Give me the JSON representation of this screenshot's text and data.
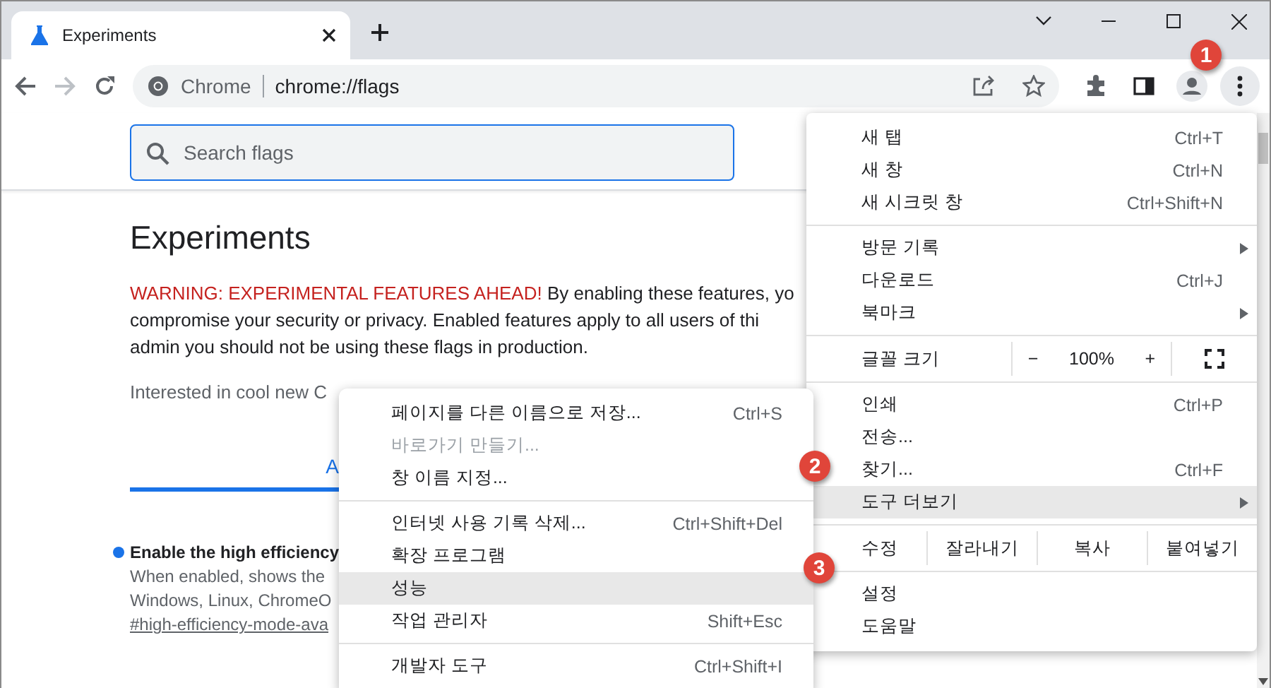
{
  "tab": {
    "title": "Experiments"
  },
  "toolbar": {
    "origin": "Chrome",
    "url": "chrome://flags"
  },
  "search": {
    "placeholder": "Search flags"
  },
  "page": {
    "heading": "Experiments",
    "warning": "WARNING: EXPERIMENTAL FEATURES AHEAD!",
    "warning_lines": [
      "By enabling these features, yo",
      "compromise your security or privacy. Enabled features apply to all users of thi",
      "admin you should not be using these flags in production."
    ],
    "interest": "Interested in cool new C",
    "tab_label": "A",
    "flag": {
      "title": "Enable the high efficiency",
      "lines": [
        "When enabled, shows the",
        "Windows, Linux, ChromeO"
      ],
      "link": "#high-efficiency-mode-ava"
    }
  },
  "main_menu": {
    "sections": [
      {
        "kind": "items",
        "items": [
          {
            "label": "새 탭",
            "shortcut": "Ctrl+T",
            "submenu": false,
            "highlighted": false,
            "disabled": false
          },
          {
            "label": "새 창",
            "shortcut": "Ctrl+N",
            "submenu": false,
            "highlighted": false,
            "disabled": false
          },
          {
            "label": "새 시크릿 창",
            "shortcut": "Ctrl+Shift+N",
            "submenu": false,
            "highlighted": false,
            "disabled": false
          }
        ]
      },
      {
        "kind": "items",
        "items": [
          {
            "label": "방문 기록",
            "submenu": true,
            "highlighted": false,
            "disabled": false
          },
          {
            "label": "다운로드",
            "shortcut": "Ctrl+J",
            "submenu": false,
            "highlighted": false,
            "disabled": false
          },
          {
            "label": "북마크",
            "submenu": true,
            "highlighted": false,
            "disabled": false
          }
        ]
      },
      {
        "kind": "zoom",
        "label": "글꼴 크기",
        "minus": "−",
        "value": "100%",
        "plus": "+"
      },
      {
        "kind": "items",
        "items": [
          {
            "label": "인쇄",
            "shortcut": "Ctrl+P",
            "submenu": false,
            "highlighted": false,
            "disabled": false
          },
          {
            "label": "전송...",
            "submenu": false,
            "highlighted": false,
            "disabled": false
          },
          {
            "label": "찾기...",
            "shortcut": "Ctrl+F",
            "submenu": false,
            "highlighted": false,
            "disabled": false
          },
          {
            "label": "도구 더보기",
            "submenu": true,
            "highlighted": true,
            "disabled": false
          }
        ]
      },
      {
        "kind": "edit",
        "label": "수정",
        "actions": [
          "잘라내기",
          "복사",
          "붙여넣기"
        ]
      },
      {
        "kind": "items",
        "items": [
          {
            "label": "설정",
            "submenu": false,
            "highlighted": false,
            "disabled": false
          },
          {
            "label": "도움말",
            "submenu": false,
            "highlighted": false,
            "disabled": false
          }
        ]
      }
    ]
  },
  "submenu": {
    "sections": [
      {
        "kind": "items",
        "items": [
          {
            "label": "페이지를 다른 이름으로 저장...",
            "shortcut": "Ctrl+S",
            "submenu": false,
            "highlighted": false,
            "disabled": false
          },
          {
            "label": "바로가기 만들기...",
            "submenu": false,
            "highlighted": false,
            "disabled": true
          },
          {
            "label": "창 이름 지정...",
            "submenu": false,
            "highlighted": false,
            "disabled": false
          }
        ]
      },
      {
        "kind": "items",
        "items": [
          {
            "label": "인터넷 사용 기록 삭제...",
            "shortcut": "Ctrl+Shift+Del",
            "submenu": false,
            "highlighted": false,
            "disabled": false
          },
          {
            "label": "확장 프로그램",
            "submenu": false,
            "highlighted": false,
            "disabled": false
          },
          {
            "label": "성능",
            "submenu": false,
            "highlighted": true,
            "disabled": false
          },
          {
            "label": "작업 관리자",
            "shortcut": "Shift+Esc",
            "submenu": false,
            "highlighted": false,
            "disabled": false
          }
        ]
      },
      {
        "kind": "items",
        "items": [
          {
            "label": "개발자 도구",
            "shortcut": "Ctrl+Shift+I",
            "submenu": false,
            "highlighted": false,
            "disabled": false
          }
        ]
      }
    ]
  },
  "badges": [
    "1",
    "2",
    "3"
  ]
}
